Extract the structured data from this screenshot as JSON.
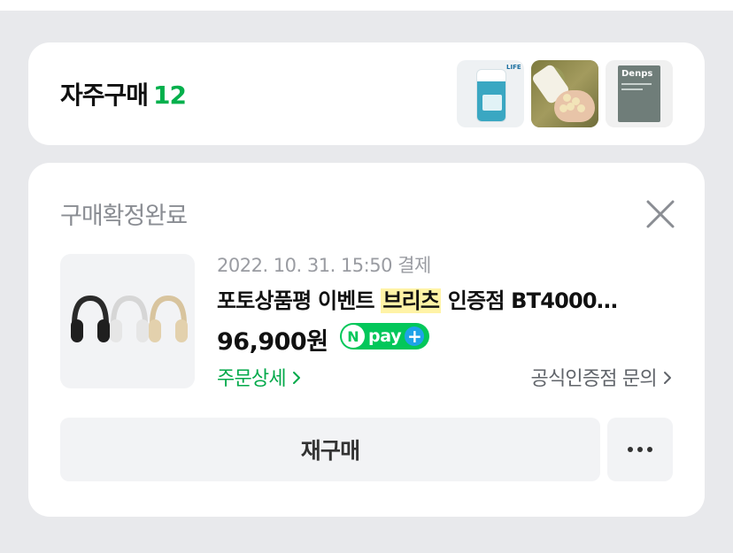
{
  "frequent": {
    "title": "자주구매",
    "count": "12",
    "thumbnails": [
      {
        "icon": "supplement-jar-image",
        "brand": "LIFE"
      },
      {
        "icon": "supplement-capsules-hand-image"
      },
      {
        "icon": "denps-box-image",
        "brand": "Denps"
      }
    ]
  },
  "order": {
    "status": "구매확정완료",
    "date": "2022. 10. 31. 15:50 결제",
    "product_name_prefix": "포토상품평 이벤트 ",
    "product_name_highlight": "브리츠",
    "product_name_suffix": " 인증점 BT4000…",
    "price": "96,900원",
    "pay": {
      "n": "N",
      "label": "pay",
      "plus": "+"
    },
    "order_detail_label": "주문상세",
    "inquiry_label": "공식인증점 문의",
    "rebuy_label": "재구매",
    "more_label": "···"
  },
  "colors": {
    "accent_green": "#03b04c",
    "npay_green": "#03c75a",
    "highlight": "#fff3a6"
  }
}
